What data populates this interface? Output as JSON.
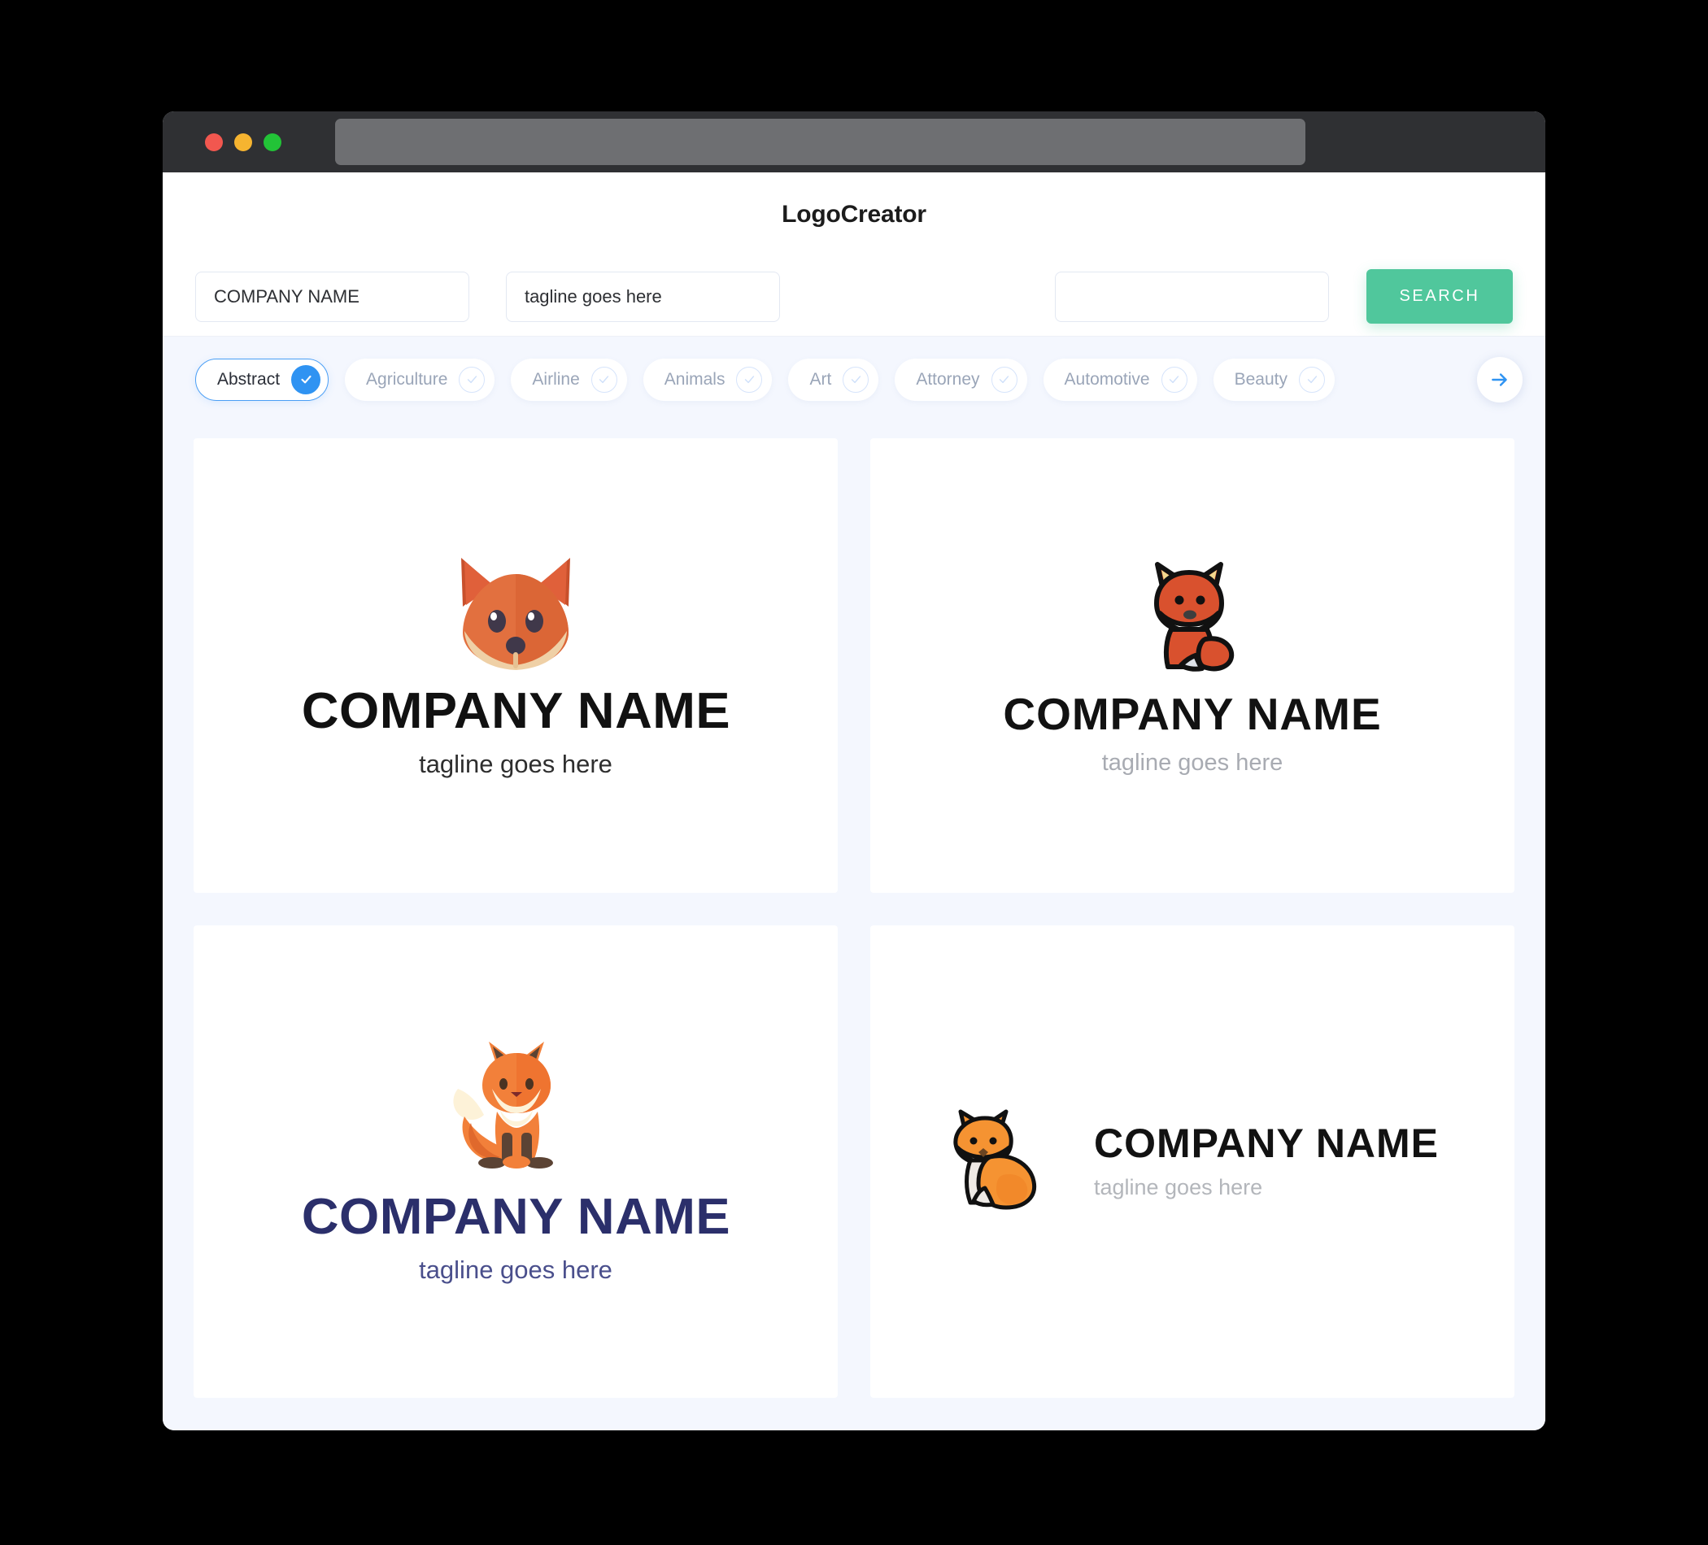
{
  "window": {
    "traffic_lights": [
      "close-red",
      "minimize-yellow",
      "maximize-green"
    ],
    "url_value": ""
  },
  "header": {
    "app_title": "LogoCreator"
  },
  "search": {
    "company_name_value": "COMPANY NAME",
    "company_name_placeholder": "COMPANY NAME",
    "tagline_value": "tagline goes here",
    "tagline_placeholder": "tagline goes here",
    "extra_value": "",
    "extra_placeholder": "",
    "search_button_label": "SEARCH"
  },
  "categories": {
    "next_arrow_icon": "arrow-right-icon",
    "items": [
      {
        "label": "Abstract",
        "selected": true
      },
      {
        "label": "Agriculture",
        "selected": false
      },
      {
        "label": "Airline",
        "selected": false
      },
      {
        "label": "Animals",
        "selected": false
      },
      {
        "label": "Art",
        "selected": false
      },
      {
        "label": "Attorney",
        "selected": false
      },
      {
        "label": "Automotive",
        "selected": false
      },
      {
        "label": "Beauty",
        "selected": false
      }
    ]
  },
  "results": {
    "cards": [
      {
        "mark_icon": "fox-head-icon",
        "company_name": "COMPANY NAME",
        "tagline": "tagline goes here",
        "layout": "stacked",
        "name_color": "#111111",
        "tagline_color": "#2e2e2e"
      },
      {
        "mark_icon": "fox-sitting-outline-icon",
        "company_name": "COMPANY NAME",
        "tagline": "tagline goes here",
        "layout": "stacked",
        "name_color": "#121212",
        "tagline_color": "#a8abb2"
      },
      {
        "mark_icon": "fox-standing-flat-icon",
        "company_name": "COMPANY NAME",
        "tagline": "tagline goes here",
        "layout": "stacked",
        "name_color": "#2b2f6b",
        "tagline_color": "#4a4f8c"
      },
      {
        "mark_icon": "fox-side-outline-icon",
        "company_name": "COMPANY NAME",
        "tagline": "tagline goes here",
        "layout": "horizontal",
        "name_color": "#121212",
        "tagline_color": "#b3b6bb"
      }
    ]
  },
  "colors": {
    "accent_green": "#50c79c",
    "accent_blue": "#2f93f2",
    "page_background": "#f4f7fe",
    "titlebar": "#2f3033",
    "navy": "#2b2f6b"
  }
}
